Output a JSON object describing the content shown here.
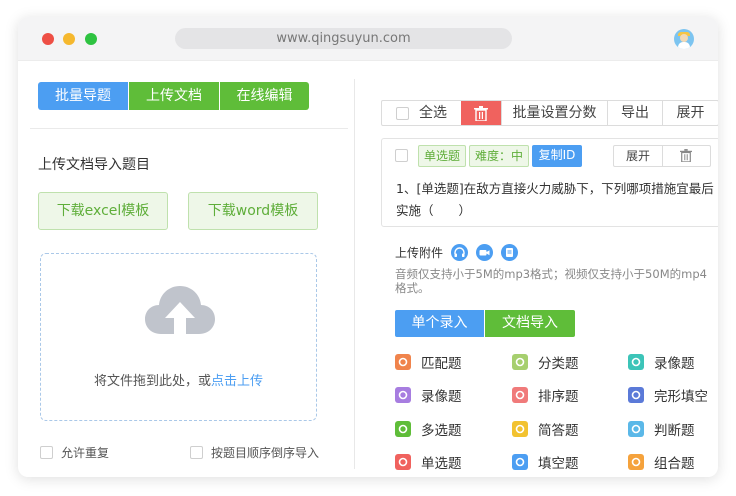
{
  "browser": {
    "url": "www.qingsuyun.com"
  },
  "left": {
    "tabs": [
      "批量导题",
      "上传文档",
      "在线编辑"
    ],
    "section_title": "上传文档导入题目",
    "download_excel": "下载excel模板",
    "download_word": "下载word模板",
    "dropzone_text": "将文件拖到此处，或",
    "dropzone_link": "点击上传",
    "allow_duplicate": "允许重复",
    "import_order": "按题目顺序倒序导入"
  },
  "right": {
    "toolbar": {
      "select_all": "全选",
      "batch_score": "批量设置分数",
      "export": "导出",
      "expand": "展开"
    },
    "question": {
      "type_tag": "单选题",
      "difficulty_tag": "难度：中",
      "copy_id": "复制ID",
      "expand": "展开",
      "text": "1、[单选题]在敌方直接火力威胁下，下列哪项措施宜最后实施（　　）"
    },
    "attachment_label": "上传附件",
    "attachment_hint": "音频仅支持小于5M的mp3格式；视频仅支持小于50M的mp4格式。",
    "entry_tabs": [
      "单个录入",
      "文档导入"
    ],
    "question_types": [
      {
        "label": "匹配题",
        "icon": "match-icon",
        "color": "#f0844c"
      },
      {
        "label": "分类题",
        "icon": "classify-icon",
        "color": "#a6cf6e"
      },
      {
        "label": "录像题",
        "icon": "video-icon",
        "color": "#3cc4b8"
      },
      {
        "label": "录像题",
        "icon": "mic-icon",
        "color": "#a77de0"
      },
      {
        "label": "排序题",
        "icon": "sort-icon",
        "color": "#f07a7a"
      },
      {
        "label": "完形填空",
        "icon": "cloze-icon",
        "color": "#5b7ad8"
      },
      {
        "label": "多选题",
        "icon": "multi-choice-icon",
        "color": "#5fbd39"
      },
      {
        "label": "简答题",
        "icon": "short-answer-icon",
        "color": "#f2c230"
      },
      {
        "label": "判断题",
        "icon": "judge-icon",
        "color": "#5bb8e8"
      },
      {
        "label": "单选题",
        "icon": "single-choice-icon",
        "color": "#f0625e"
      },
      {
        "label": "填空题",
        "icon": "fill-blank-icon",
        "color": "#4c9ef2"
      },
      {
        "label": "组合题",
        "icon": "combo-icon",
        "color": "#f5a23c"
      }
    ]
  }
}
